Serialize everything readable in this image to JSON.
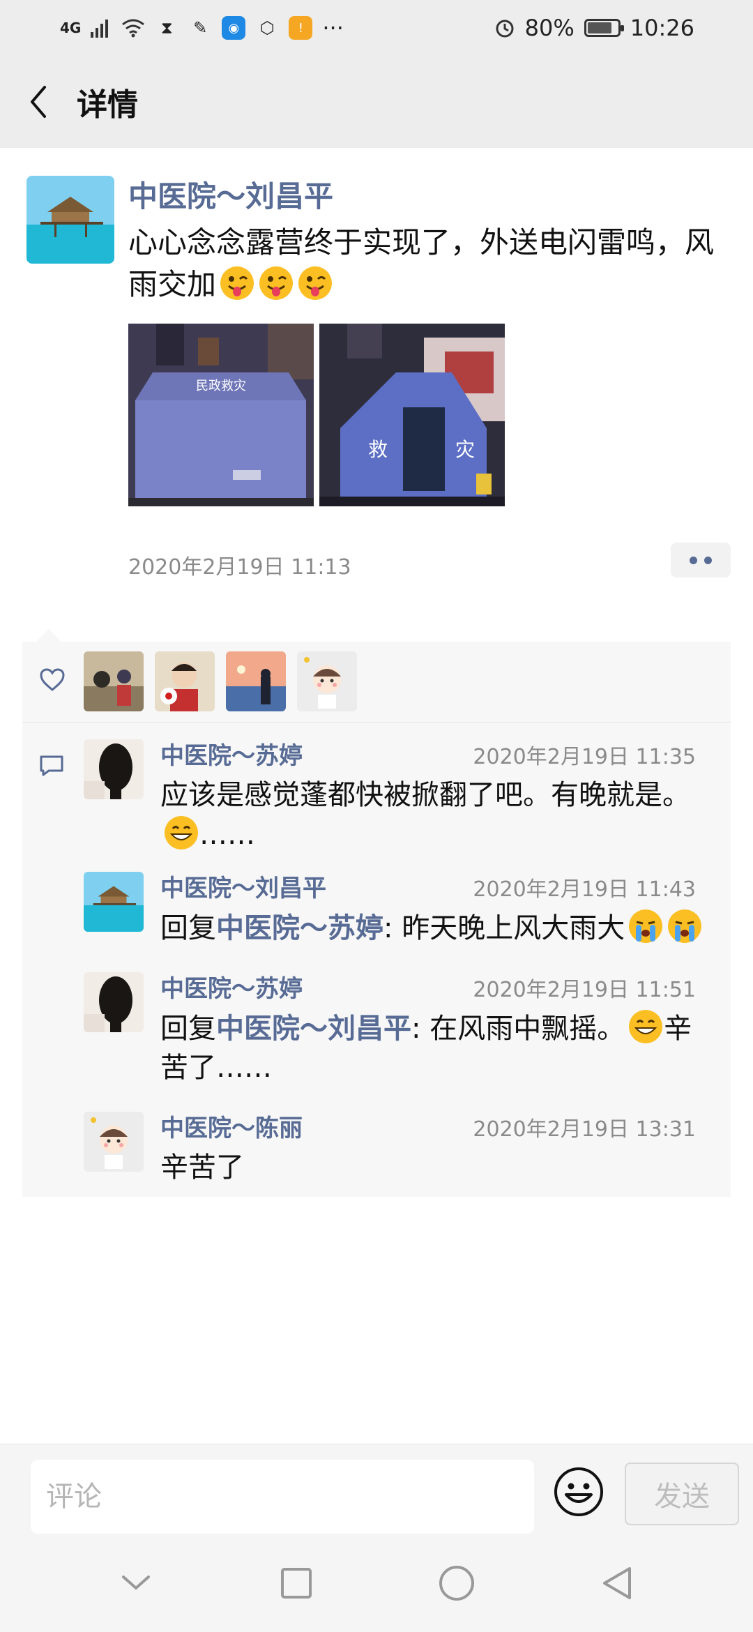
{
  "status_bar": {
    "network": "4G",
    "battery": "80%",
    "battery_level": 0.8,
    "time": "10:26",
    "more": "···"
  },
  "header": {
    "title": "详情"
  },
  "post": {
    "author": "中医院～刘昌平",
    "text": "心心念念露营终于实现了，外送电闪雷鸣，风雨交加",
    "emojis": [
      "wink-tongue-emoji",
      "wink-tongue-emoji",
      "wink-tongue-emoji"
    ],
    "photo_texts": [
      "民政救灾",
      "救",
      "灾"
    ],
    "time": "2020年2月19日 11:13"
  },
  "comments": [
    {
      "name": "中医院～苏婷",
      "time": "2020年2月19日 11:35",
      "text": "应该是感觉蓬都快被掀翻了吧。有晚就是。",
      "suffix": "……"
    },
    {
      "name": "中医院～刘昌平",
      "time": "2020年2月19日 11:43",
      "reply_prefix": "回复",
      "reply_target": "中医院～苏婷",
      "text": ": 昨天晚上风大雨大"
    },
    {
      "name": "中医院～苏婷",
      "time": "2020年2月19日 11:51",
      "reply_prefix": "回复",
      "reply_target": "中医院～刘昌平",
      "text": ": 在风雨中飘摇。",
      "suffix": "辛苦了……"
    },
    {
      "name": "中医院～陈丽",
      "time": "2020年2月19日 13:31",
      "text": "辛苦了"
    }
  ],
  "input": {
    "placeholder": "评论",
    "send_label": "发送"
  },
  "colors": {
    "link": "#576b95",
    "header_bg": "#ededed",
    "panel_bg": "#f7f7f7"
  }
}
